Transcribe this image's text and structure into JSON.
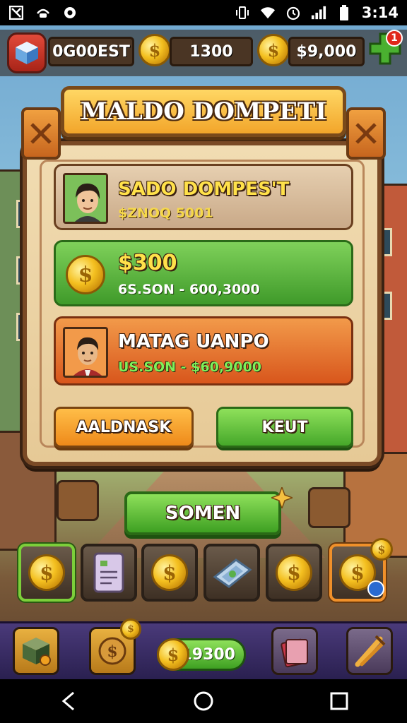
{
  "status_bar": {
    "time": "3:14"
  },
  "hud": {
    "player_name": "0G00EST",
    "coins": "1300",
    "cash": "$9,000",
    "notification_count": "1"
  },
  "dialog": {
    "title": "MALDO DOMPETI",
    "rows": [
      {
        "title": "SADO DOMPES'T",
        "subtitle": "$ZNOQ 5001"
      },
      {
        "title": "$300",
        "subtitle": "6S.SON - 600,3000"
      },
      {
        "title": "MATAG UANPO",
        "subtitle": "US.SON - $60,9000"
      }
    ],
    "left_button": "AALDNASK",
    "right_button": "KEUT"
  },
  "main_button": "SOMEN",
  "bottom_bar": {
    "counter": "19300"
  },
  "colors": {
    "accent_green": "#46a82a",
    "accent_orange": "#ee8a1a",
    "title_gold": "#f2a52a"
  }
}
